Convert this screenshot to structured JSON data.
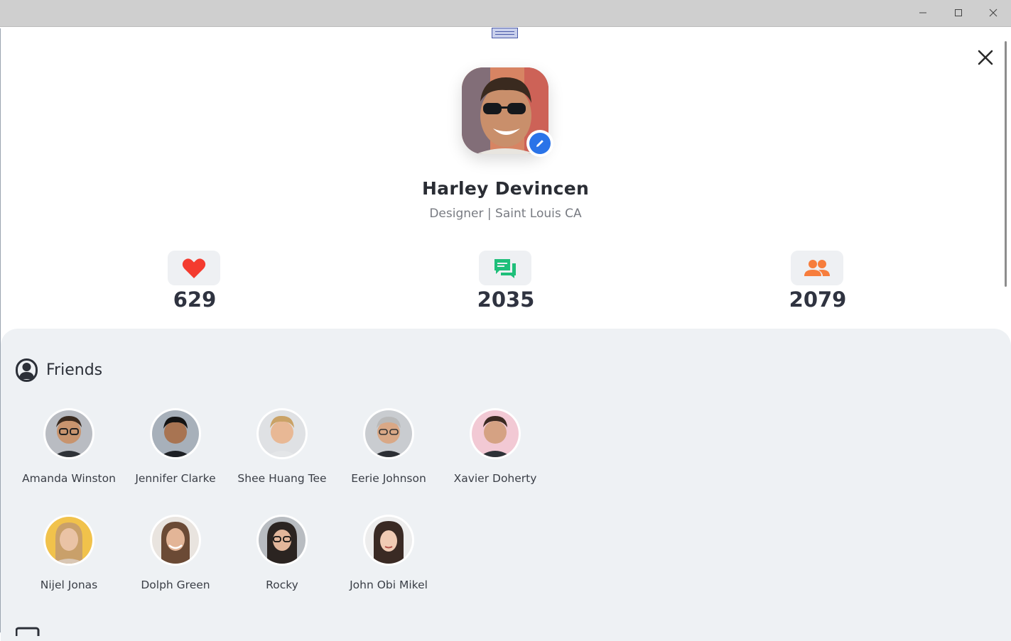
{
  "window": {
    "minimize_icon": "minimize-icon",
    "maximize_icon": "maximize-icon",
    "close_icon": "close-icon"
  },
  "profile": {
    "name": "Harley Devincen",
    "subtitle": "Designer | Saint Louis CA",
    "edit_icon": "pencil-icon"
  },
  "stats": [
    {
      "icon": "heart-icon",
      "value": "629",
      "color": "#f43b2f"
    },
    {
      "icon": "chat-icon",
      "value": "2035",
      "color": "#1fbf7a"
    },
    {
      "icon": "people-icon",
      "value": "2079",
      "color": "#f77d3c"
    }
  ],
  "friends": {
    "title": "Friends",
    "icon": "person-icon",
    "items": [
      {
        "name": "Amanda Winston"
      },
      {
        "name": "Jennifer Clarke"
      },
      {
        "name": "Shee Huang Tee"
      },
      {
        "name": "Eerie Johnson"
      },
      {
        "name": "Xavier Doherty"
      },
      {
        "name": "Nijel Jonas"
      },
      {
        "name": "Dolph Green"
      },
      {
        "name": "Rocky"
      },
      {
        "name": "John Obi Mikel"
      }
    ]
  }
}
